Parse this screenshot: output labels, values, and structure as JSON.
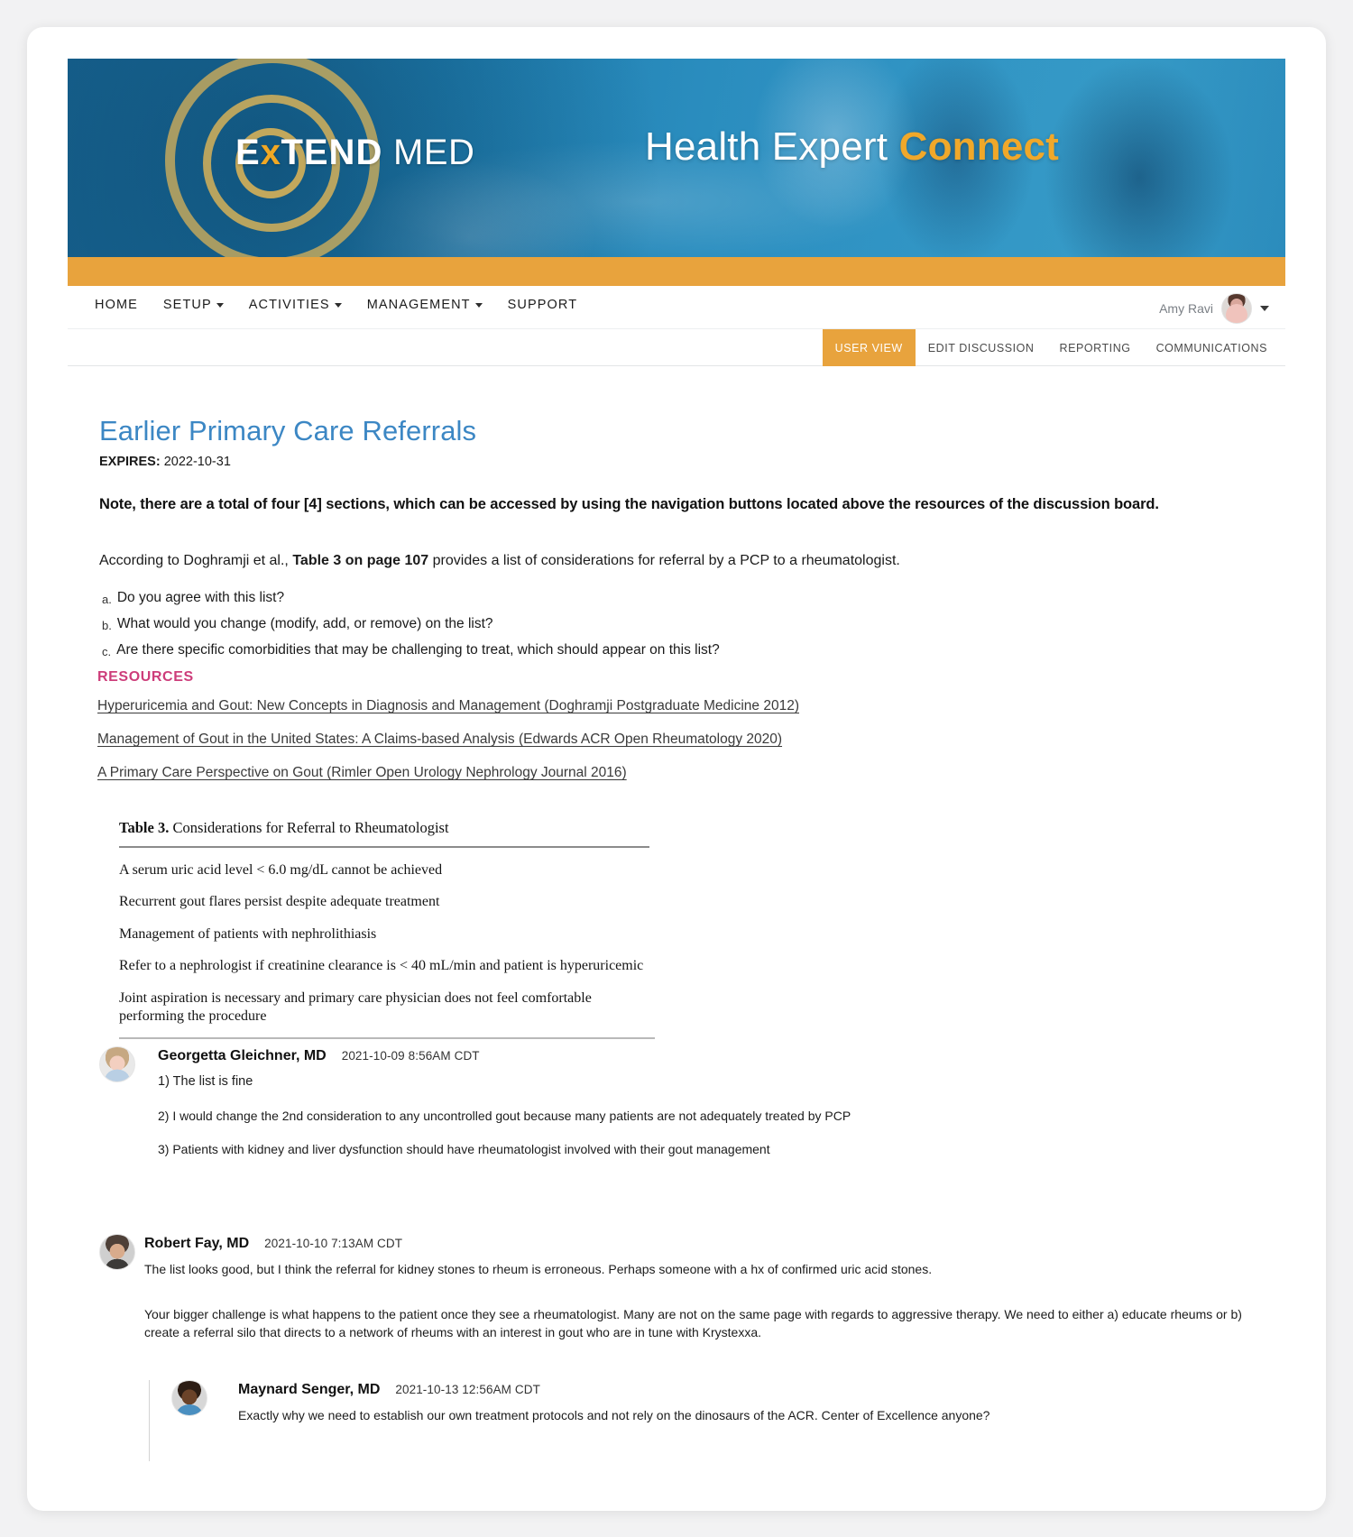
{
  "banner": {
    "brand_ex": "E",
    "brand_x": "x",
    "brand_tend": "TEND",
    "brand_med": "MED",
    "tagline_main": "Health Expert ",
    "tagline_accent": "Connect",
    "accent_color": "#f0a82a",
    "strip_color": "#e8a33d"
  },
  "nav": {
    "items": [
      {
        "label": "HOME",
        "has_caret": false
      },
      {
        "label": "SETUP",
        "has_caret": true
      },
      {
        "label": "ACTIVITIES",
        "has_caret": true
      },
      {
        "label": "MANAGEMENT",
        "has_caret": true
      },
      {
        "label": "SUPPORT",
        "has_caret": false
      }
    ],
    "user": {
      "name": "Amy Ravi"
    }
  },
  "tabs": [
    {
      "label": "USER VIEW",
      "active": true
    },
    {
      "label": "EDIT DISCUSSION",
      "active": false
    },
    {
      "label": "REPORTING",
      "active": false
    },
    {
      "label": "COMMUNICATIONS",
      "active": false
    }
  ],
  "page": {
    "title": "Earlier Primary Care Referrals",
    "expires_label": "EXPIRES:",
    "expires_value": "2022-10-31",
    "note": "Note, there are a total of four [4] sections, which can be accessed by using the navigation buttons located above the resources of the discussion board.",
    "intro_pre": "According to Doghramji et al., ",
    "intro_bold": "Table 3 on page 107",
    "intro_post": " provides a list of considerations for referral by a PCP to a rheumatologist.",
    "questions": [
      {
        "marker": "a.",
        "text": "Do you agree with this list?"
      },
      {
        "marker": "b.",
        "text": "What would you change (modify, add, or remove) on the list?"
      },
      {
        "marker": "c.",
        "text": "Are there specific comorbidities that may be challenging to treat, which should appear on this list?"
      }
    ]
  },
  "resources": {
    "heading": "RESOURCES",
    "heading_color": "#cd3d7a",
    "links": [
      "Hyperuricemia and Gout: New Concepts in Diagnosis and Management (Doghramji Postgraduate Medicine 2012)",
      "Management of Gout in the United States: A Claims-based Analysis (Edwards ACR Open Rheumatology 2020)",
      "A Primary Care Perspective on Gout (Rimler Open Urology Nephrology Journal 2016)"
    ]
  },
  "table3": {
    "caption_bold": "Table 3.",
    "caption_rest": " Considerations for Referral to Rheumatologist",
    "rows": [
      "A serum uric acid level < 6.0 mg/dL cannot be achieved",
      "Recurrent gout flares persist despite adequate treatment",
      "Management of patients with nephrolithiasis",
      "Refer to a nephrologist if creatinine clearance is < 40 mL/min and patient is hyperuricemic",
      "Joint aspiration is necessary and primary care physician does not feel comfortable performing the procedure"
    ]
  },
  "comments": [
    {
      "name": "Georgetta Gleichner, MD",
      "time": "2021-10-09 8:56AM CDT",
      "paragraphs": [
        "1) The list is fine",
        "2) I would change the 2nd consideration to any uncontrolled gout because many patients are not adequately treated by PCP",
        "3) Patients with kidney and liver dysfunction should have rheumatologist involved with their gout management"
      ]
    },
    {
      "name": "Robert Fay, MD",
      "time": "2021-10-10 7:13AM CDT",
      "paragraphs": [
        "The list looks good, but I think the referral for kidney stones to rheum is erroneous.  Perhaps someone with a hx of confirmed uric acid stones.",
        "Your bigger challenge is what happens to the patient once they see a rheumatologist.  Many are not on the same page with regards to aggressive therapy. We need to either a) educate rheums or b) create a referral silo that directs to a network of rheums with an interest in gout who are in tune with Krystexxa."
      ]
    },
    {
      "name": "Maynard Senger, MD",
      "time": "2021-10-13 12:56AM CDT",
      "paragraphs": [
        "Exactly why we need to establish our own treatment protocols and not rely on the dinosaurs of the ACR. Center of Excellence anyone?"
      ]
    }
  ]
}
